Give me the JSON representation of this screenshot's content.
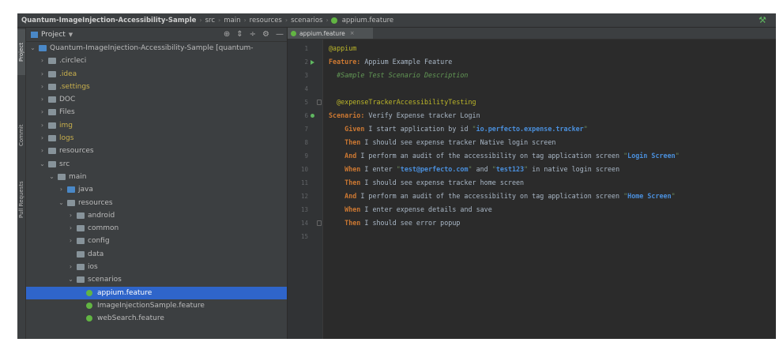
{
  "breadcrumb": [
    "Quantum-ImageInjection-Accessibility-Sample",
    "src",
    "main",
    "resources",
    "scenarios",
    "appium.feature"
  ],
  "toolstrip": [
    "Project",
    "Commit",
    "Pull Requests"
  ],
  "project_panel": {
    "title": "Project",
    "tree": [
      {
        "label": "Quantum-ImageInjection-Accessibility-Sample [quantum-",
        "depth": 0,
        "arrow": "down",
        "icon": "module"
      },
      {
        "label": ".circleci",
        "depth": 1,
        "arrow": "right",
        "icon": "folder"
      },
      {
        "label": ".idea",
        "depth": 1,
        "arrow": "right",
        "icon": "folder",
        "muted": true
      },
      {
        "label": ".settings",
        "depth": 1,
        "arrow": "right",
        "icon": "folder",
        "muted": true
      },
      {
        "label": "DOC",
        "depth": 1,
        "arrow": "right",
        "icon": "folder"
      },
      {
        "label": "Files",
        "depth": 1,
        "arrow": "right",
        "icon": "folder"
      },
      {
        "label": "img",
        "depth": 1,
        "arrow": "right",
        "icon": "folder",
        "muted": true
      },
      {
        "label": "logs",
        "depth": 1,
        "arrow": "right",
        "icon": "folder",
        "muted": true
      },
      {
        "label": "resources",
        "depth": 1,
        "arrow": "right",
        "icon": "folder"
      },
      {
        "label": "src",
        "depth": 1,
        "arrow": "down",
        "icon": "folder"
      },
      {
        "label": "main",
        "depth": 2,
        "arrow": "down",
        "icon": "folder"
      },
      {
        "label": "java",
        "depth": 3,
        "arrow": "right",
        "icon": "source"
      },
      {
        "label": "resources",
        "depth": 3,
        "arrow": "down",
        "icon": "folder"
      },
      {
        "label": "android",
        "depth": 4,
        "arrow": "right",
        "icon": "folder"
      },
      {
        "label": "common",
        "depth": 4,
        "arrow": "right",
        "icon": "folder"
      },
      {
        "label": "config",
        "depth": 4,
        "arrow": "right",
        "icon": "folder"
      },
      {
        "label": "data",
        "depth": 4,
        "arrow": "",
        "icon": "folder"
      },
      {
        "label": "ios",
        "depth": 4,
        "arrow": "right",
        "icon": "folder"
      },
      {
        "label": "scenarios",
        "depth": 4,
        "arrow": "down",
        "icon": "folder"
      },
      {
        "label": "appium.feature",
        "depth": 5,
        "arrow": "",
        "icon": "feature",
        "selected": true
      },
      {
        "label": "ImageInjectionSample.feature",
        "depth": 5,
        "arrow": "",
        "icon": "feature"
      },
      {
        "label": "webSearch.feature",
        "depth": 5,
        "arrow": "",
        "icon": "feature"
      }
    ]
  },
  "editor": {
    "tab_label": "appium.feature",
    "lines": [
      {
        "n": "1",
        "parts": [
          [
            "t",
            "@appium"
          ]
        ]
      },
      {
        "n": "2",
        "parts": [
          [
            "k",
            "Feature:"
          ],
          [
            "txt",
            " Appium Example Feature"
          ]
        ],
        "marker": "run"
      },
      {
        "n": "3",
        "parts": [
          [
            "c",
            "  #Sample Test Scenario Description"
          ]
        ]
      },
      {
        "n": "4",
        "parts": []
      },
      {
        "n": "5",
        "parts": [
          [
            "t",
            "  @expenseTrackerAccessibilityTesting"
          ]
        ],
        "fold": true
      },
      {
        "n": "6",
        "parts": [
          [
            "k",
            "Scenario:"
          ],
          [
            "txt",
            " Verify Expense tracker Login"
          ]
        ],
        "marker": "dot"
      },
      {
        "n": "7",
        "parts": [
          [
            "k",
            "    Given"
          ],
          [
            "txt",
            " I start application by id "
          ],
          [
            "s",
            "\""
          ],
          [
            "q",
            "io.perfecto.expense.tracker"
          ],
          [
            "s",
            "\""
          ]
        ]
      },
      {
        "n": "8",
        "parts": [
          [
            "k",
            "    Then"
          ],
          [
            "txt",
            " I should see expense tracker Native login screen"
          ]
        ]
      },
      {
        "n": "9",
        "parts": [
          [
            "k",
            "    And"
          ],
          [
            "txt",
            " I perform an audit of the accessibility on tag application screen "
          ],
          [
            "s",
            "\""
          ],
          [
            "q",
            "Login Screen"
          ],
          [
            "s",
            "\""
          ]
        ]
      },
      {
        "n": "10",
        "parts": [
          [
            "k",
            "    When"
          ],
          [
            "txt",
            " I enter "
          ],
          [
            "s",
            "\""
          ],
          [
            "q",
            "test@perfecto.com"
          ],
          [
            "s",
            "\""
          ],
          [
            "txt",
            " and "
          ],
          [
            "s",
            "\""
          ],
          [
            "q",
            "test123"
          ],
          [
            "s",
            "\""
          ],
          [
            "txt",
            " in native login screen"
          ]
        ]
      },
      {
        "n": "11",
        "parts": [
          [
            "k",
            "    Then"
          ],
          [
            "txt",
            " I should see expense tracker home screen"
          ]
        ]
      },
      {
        "n": "12",
        "parts": [
          [
            "k",
            "    And"
          ],
          [
            "txt",
            " I perform an audit of the accessibility on tag application screen "
          ],
          [
            "s",
            "\""
          ],
          [
            "q",
            "Home Screen"
          ],
          [
            "s",
            "\""
          ]
        ]
      },
      {
        "n": "13",
        "parts": [
          [
            "k",
            "    When"
          ],
          [
            "txt",
            " I enter expense details and save"
          ]
        ]
      },
      {
        "n": "14",
        "parts": [
          [
            "k",
            "    Then"
          ],
          [
            "txt",
            " I should see error popup"
          ]
        ],
        "fold": true
      },
      {
        "n": "15",
        "parts": []
      }
    ]
  },
  "colors": {
    "accent": "#2f65ca",
    "feature_icon": "#62b543",
    "keyword": "#cc7832",
    "tag": "#bbb529",
    "string": "#4a8fdc"
  }
}
